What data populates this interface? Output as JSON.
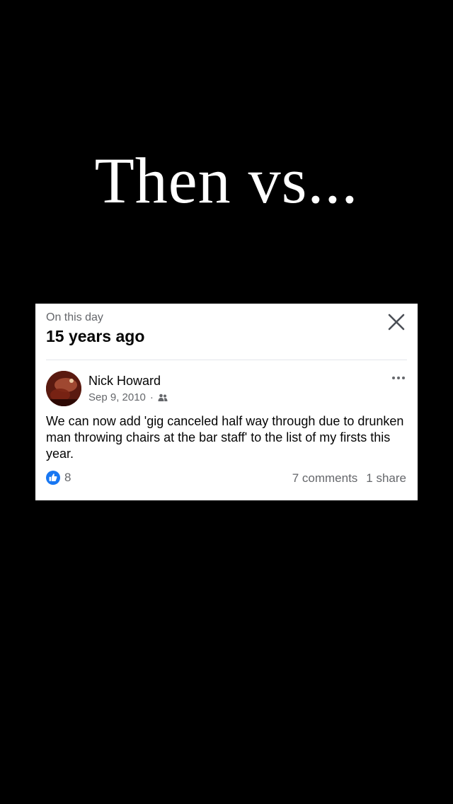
{
  "headline": "Then vs...",
  "memory": {
    "label": "On this day",
    "title": "15 years ago"
  },
  "post": {
    "author": "Nick Howard",
    "date": "Sep 9, 2010",
    "separator": "·",
    "audience_icon": "friends-icon",
    "text": "We can now add 'gig canceled half way through due to drunken man throwing chairs at the bar staff' to the list of my firsts this year.",
    "reaction_icon": "like-icon",
    "reactions_count": "8",
    "comments": "7 comments",
    "shares": "1 share"
  },
  "colors": {
    "background": "#000000",
    "card": "#ffffff",
    "accent": "#1877f2",
    "secondary_text": "#65676b"
  }
}
